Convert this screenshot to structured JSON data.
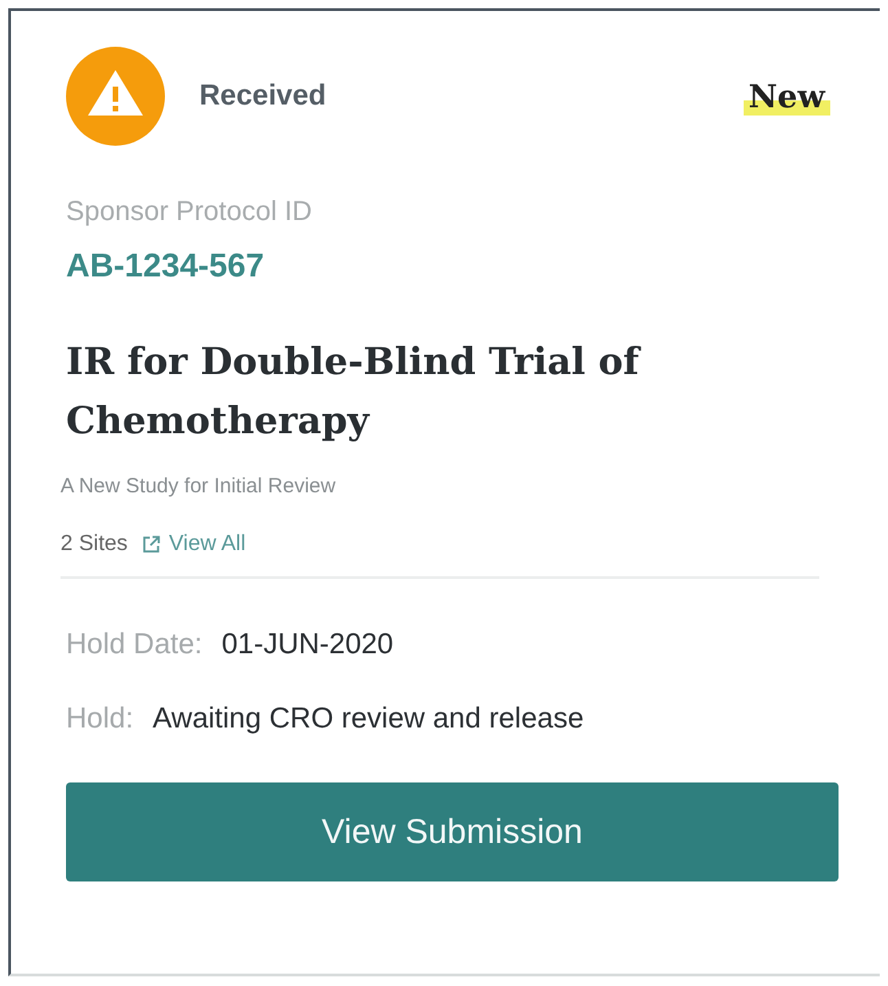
{
  "status": {
    "label": "Received",
    "badge": "New"
  },
  "protocol": {
    "label": "Sponsor Protocol ID",
    "id": "AB-1234-567"
  },
  "title": "IR for Double-Blind Trial of Chemotherapy",
  "subtitle": "A New Study for Initial Review",
  "sites": {
    "count": "2 Sites",
    "link": "View All"
  },
  "details": [
    {
      "label": "Hold Date:",
      "value": "01-JUN-2020"
    },
    {
      "label": "Hold:",
      "value": "Awaiting CRO review and release"
    }
  ],
  "button": "View Submission"
}
